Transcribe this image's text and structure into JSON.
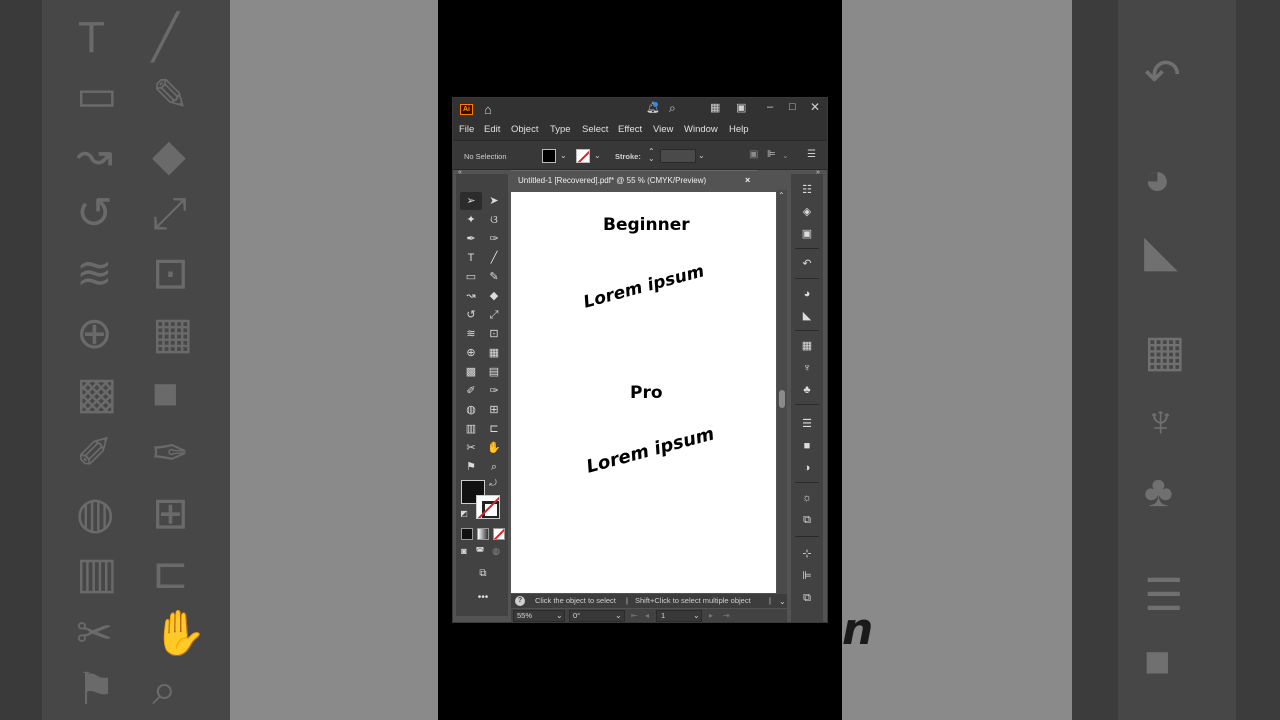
{
  "window": {
    "app_logo": "Ai"
  },
  "menu": [
    "File",
    "Edit",
    "Object",
    "Type",
    "Select",
    "Effect",
    "View",
    "Window",
    "Help"
  ],
  "control_bar": {
    "selection_label": "No Selection",
    "stroke_label": "Stroke:"
  },
  "document_tab": {
    "title": "Untitled-1 [Recovered].pdf* @ 55 % (CMYK/Preview)",
    "close": "×"
  },
  "artboard": {
    "heading1": "Beginner",
    "text1": "Lorem ipsum",
    "heading2": "Pro",
    "text2": "Lorem ipsum"
  },
  "status": {
    "help_icon": "?",
    "hint1": "Click the object to select",
    "sep": "|",
    "hint2": "Shift+Click to select multiple object",
    "sep2": "|"
  },
  "zoom": {
    "level": "55%",
    "rotation": "0°",
    "artboard_number": "1"
  },
  "background_text": "n",
  "colors": {
    "fill": "#000000",
    "stroke_none": "#e02020",
    "accent": "#ff7c00"
  }
}
